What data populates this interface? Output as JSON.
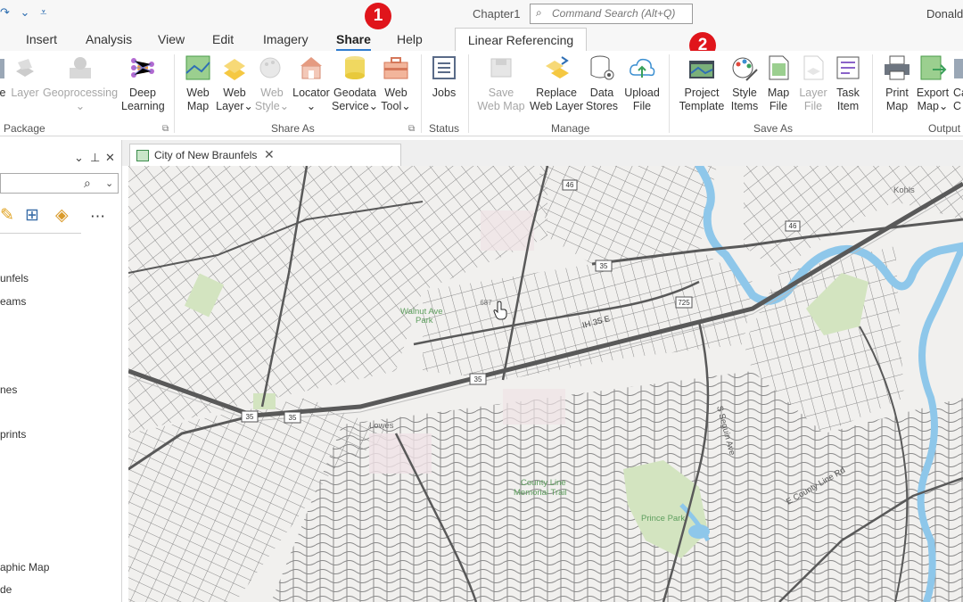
{
  "window": {
    "document_title": "Chapter1",
    "command_search_placeholder": "Command Search (Alt+Q)",
    "user_name": "Donald"
  },
  "quick_access": [
    "↷",
    "⌄",
    "⩡"
  ],
  "ribbon_tabs": [
    {
      "label": "Insert"
    },
    {
      "label": "Analysis"
    },
    {
      "label": "View"
    },
    {
      "label": "Edit"
    },
    {
      "label": "Imagery"
    },
    {
      "label": "Share",
      "active": true
    },
    {
      "label": "Help"
    }
  ],
  "contextual_tab": "Linear Referencing",
  "callouts": [
    "1",
    "2"
  ],
  "ribbon_groups": {
    "package": {
      "label": "Package",
      "buttons": [
        {
          "line1": "e",
          "line2": "",
          "icon": "package-icon",
          "disabled": false
        },
        {
          "line1": "Layer",
          "line2": "",
          "icon": "layer-package-icon",
          "disabled": true
        },
        {
          "line1": "Geoprocessing",
          "line2": "⌄",
          "icon": "geoprocessing-package-icon",
          "disabled": true
        },
        {
          "line1": "Deep",
          "line2": "Learning",
          "icon": "deep-learning-icon",
          "disabled": false
        }
      ]
    },
    "share_as": {
      "label": "Share As",
      "buttons": [
        {
          "line1": "Web",
          "line2": "Map",
          "icon": "web-map-icon",
          "disabled": false
        },
        {
          "line1": "Web",
          "line2": "Layer⌄",
          "icon": "web-layer-icon",
          "disabled": false
        },
        {
          "line1": "Web",
          "line2": "Style⌄",
          "icon": "web-style-icon",
          "disabled": true
        },
        {
          "line1": "Locator",
          "line2": "⌄",
          "icon": "locator-icon",
          "disabled": false
        },
        {
          "line1": "Geodata",
          "line2": "Service⌄",
          "icon": "geodata-service-icon",
          "disabled": false
        },
        {
          "line1": "Web",
          "line2": "Tool⌄",
          "icon": "web-tool-icon",
          "disabled": false
        }
      ]
    },
    "status": {
      "label": "Status",
      "buttons": [
        {
          "line1": "Jobs",
          "line2": "",
          "icon": "jobs-icon",
          "disabled": false
        }
      ]
    },
    "manage": {
      "label": "Manage",
      "buttons": [
        {
          "line1": "Save",
          "line2": "Web Map",
          "icon": "save-web-map-icon",
          "disabled": true
        },
        {
          "line1": "Replace",
          "line2": "Web Layer",
          "icon": "replace-web-layer-icon",
          "disabled": false
        },
        {
          "line1": "Data",
          "line2": "Stores",
          "icon": "data-stores-icon",
          "disabled": false
        },
        {
          "line1": "Upload",
          "line2": "File",
          "icon": "upload-file-icon",
          "disabled": false
        }
      ]
    },
    "save_as": {
      "label": "Save As",
      "buttons": [
        {
          "line1": "Project",
          "line2": "Template",
          "icon": "project-template-icon",
          "disabled": false
        },
        {
          "line1": "Style",
          "line2": "Items",
          "icon": "style-items-icon",
          "disabled": false
        },
        {
          "line1": "Map",
          "line2": "File",
          "icon": "map-file-icon",
          "disabled": false
        },
        {
          "line1": "Layer",
          "line2": "File",
          "icon": "layer-file-icon",
          "disabled": true
        },
        {
          "line1": "Task",
          "line2": "Item",
          "icon": "task-item-icon",
          "disabled": false
        }
      ]
    },
    "output": {
      "label": "Output",
      "buttons": [
        {
          "line1": "Print",
          "line2": "Map",
          "icon": "print-map-icon",
          "disabled": false
        },
        {
          "line1": "Export",
          "line2": "Map⌄",
          "icon": "export-map-icon",
          "disabled": false
        },
        {
          "line1": "Ca",
          "line2": "C",
          "icon": "copy-icon",
          "disabled": false
        }
      ]
    }
  },
  "left_pane": {
    "controls": [
      "⌄",
      "⊕",
      "✕"
    ],
    "search_icon": "search-icon",
    "toc_items": [
      "unfels",
      "eams",
      "nes",
      "prints",
      "aphic Map",
      "de"
    ]
  },
  "map_view": {
    "tab_label": "City of New Braunfels",
    "close_glyph": "✕",
    "labels": {
      "kohls": "Kohls",
      "walnut_ave_park_1": "Walnut Ave",
      "walnut_ave_park_2": "Park",
      "lowes": "Lowes",
      "county_line_1": "County Line",
      "county_line_2": "Memorial Trail",
      "prince_park": "Prince Park",
      "ih35": "IH 35 E",
      "route_46a": "46",
      "route_46b": "46",
      "route_35a": "35",
      "route_35b": "35",
      "route_35c": "35",
      "route_35d": "35",
      "route_35e": "35",
      "route_725": "725",
      "map_label_687": "687",
      "s_seguin": "S Seguin Ave",
      "e_county_line": "E County Line Rd"
    },
    "colors": {
      "water": "#8ec7ea",
      "park": "#d3e4c0",
      "road": "#7c7c7c",
      "highway": "#595959",
      "land": "#f1f0ee"
    }
  }
}
